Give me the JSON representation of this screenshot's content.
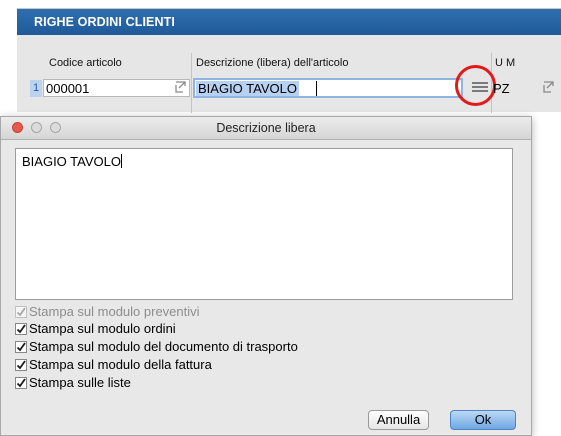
{
  "grid": {
    "title": "RIGHE ORDINI CLIENTI",
    "columns": {
      "code": "Codice articolo",
      "description": "Descrizione (libera) dell'articolo",
      "um": "U M"
    },
    "row": {
      "number": "1",
      "code": "000001",
      "description": "BIAGIO TAVOLO",
      "um": "PZ"
    },
    "icons": {
      "lookup": "lookup-arrow-icon",
      "list": "list-icon"
    }
  },
  "dialog": {
    "title": "Descrizione libera",
    "text": "BIAGIO TAVOLO",
    "options": [
      {
        "label": "Stampa sul modulo preventivi",
        "checked": true,
        "enabled": false
      },
      {
        "label": "Stampa sul modulo ordini",
        "checked": true,
        "enabled": true
      },
      {
        "label": "Stampa sul modulo del documento di trasporto",
        "checked": true,
        "enabled": true
      },
      {
        "label": "Stampa sul modulo della fattura",
        "checked": true,
        "enabled": true
      },
      {
        "label": "Stampa sulle liste",
        "checked": true,
        "enabled": true
      }
    ],
    "buttons": {
      "cancel": "Annulla",
      "ok": "Ok"
    }
  },
  "colors": {
    "header_blue": "#2f6fb0",
    "highlight_red": "#e11a1a",
    "selection_blue": "#b6d1f2",
    "ok_button_blue": "#6fa8e4"
  }
}
